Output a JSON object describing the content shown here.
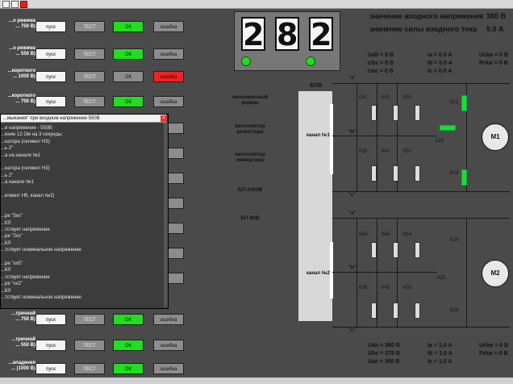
{
  "toolbar": {
    "items": [
      "app-icon",
      "save-icon",
      "settings-icon",
      "close-icon"
    ]
  },
  "rows": [
    {
      "label": "...о режима\n... 750 В)",
      "start": "пуск",
      "test": "ТЕСТ",
      "ok": "ОК",
      "err": "ошибка",
      "ok_color": "#22dd22",
      "err_color": "#8c8c8c"
    },
    {
      "label": "...о режима\n... 550 В)",
      "start": "пуск",
      "test": "ТЕСТ",
      "ok": "ОК",
      "err": "ошибка",
      "ok_color": "#22dd22",
      "err_color": "#8c8c8c"
    },
    {
      "label": "...короткого\n... 1000 В)",
      "start": "пуск",
      "test": "ТЕСТ",
      "ok": "ОК",
      "err": "ошибка",
      "ok_color": "#8c8c8c",
      "err_color": "#ee2222"
    },
    {
      "label": "...короткого\n... 750 В)",
      "start": "пуск",
      "test": "ТЕСТ",
      "ok": "ОК",
      "err": "ошибка",
      "ok_color": "#22dd22",
      "err_color": "#8c8c8c"
    }
  ],
  "bottom_rows": [
    {
      "label": "...тричной\n... 750 В)",
      "start": "пуск",
      "test": "ТЕСТ",
      "ok": "ОК",
      "err": "ошибка",
      "ok_color": "#22dd22",
      "err_color": "#8c8c8c"
    },
    {
      "label": "...тричной\n... 550 В)",
      "start": "пуск",
      "test": "ТЕСТ",
      "ok": "ОК",
      "err": "ошибка",
      "ok_color": "#22dd22",
      "err_color": "#8c8c8c"
    },
    {
      "label": "...ападения\n... (1000 В)",
      "start": "пуск",
      "test": "ТЕСТ",
      "ok": "ОК",
      "err": "ошибка",
      "ok_color": "#22dd22",
      "err_color": "#8c8c8c"
    }
  ],
  "hidden_ok_count": 7,
  "counter": {
    "d1": "2",
    "d2": "8",
    "d3": "2"
  },
  "top_readout": {
    "voltage_label": "значение входного напряжения",
    "voltage_value": "380 В",
    "current_label": "значение силы входного тока",
    "current_value": "5.0 А"
  },
  "meters_top": {
    "uab": "Uab = 0 В",
    "ubc": "Ubc = 0 В",
    "uac": "Uac = 0 В",
    "ia": "Ia = 0.0 А",
    "ib": "Ib = 0.0 А",
    "ic": "Ic = 0.0 А",
    "ucsv": "Uсkв = 0 В",
    "rcsv": "Pсkв = 0 В"
  },
  "meters_bottom": {
    "uab": "Uab = 380 В",
    "ubc": "Ubc = 378 В",
    "uac": "Uac = 380 В",
    "ia": "Ia = 1.0 А",
    "ib": "Ib = 1.0 А",
    "ic": "Ic = 1.0 А",
    "ucsv": "Uсkв = 0 В",
    "rcsv": "Pсkв = 0 В"
  },
  "modes": [
    "экономичный режим",
    "вентилятор резистора",
    "вентилятор инвертора",
    "БП 1000В",
    "БП 80В"
  ],
  "bpv": "БПВ",
  "channel1": "канал №1",
  "channel2": "канал №2",
  "phases": {
    "a": "\"a\"",
    "b": "\"b\"",
    "c": "\"c\""
  },
  "contactors_top": [
    "К31",
    "К41",
    "К51",
    "К32",
    "К42",
    "К52",
    "К21",
    "К22",
    "К23"
  ],
  "contactors_bottom": [
    "К34",
    "К44",
    "К54",
    "К35",
    "К45",
    "К55",
    "К24",
    "К25",
    "К26"
  ],
  "motors": [
    "М1",
    "М2"
  ],
  "dialog": {
    "title": "...мыкания\" при входном напряжении 550В",
    "lines": [
      "...е напряжение - 550В;",
      "...ение 12 Ом на 3 секунды;",
      "...катора (сегмент Н3)",
      "...ь 2\"",
      "...а на канале №1",
      "",
      "...катора (сегмент Н3)",
      "...ь 2\"",
      "...а канале №1",
      "",
      "...егмент Н9, канал №2)",
      "",
      "",
      "...ре \"5хх\"",
      "...КЛ",
      "...тствует напряжение",
      "...ре \"2хх\"",
      "...КЛ",
      "...тствует номинальное напряжение",
      "",
      "...ре \"хх5\"",
      "...КЛ",
      "...тствует напряжение",
      "...ре \"хх2\"",
      "...КЛ",
      "...тствует номинальное напряжение"
    ]
  }
}
